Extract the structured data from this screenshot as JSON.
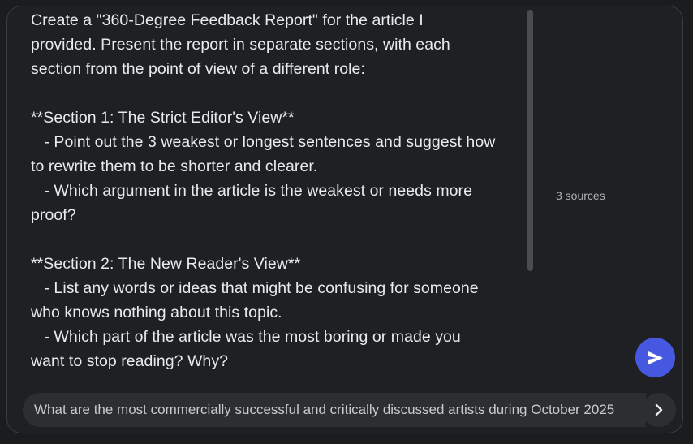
{
  "prompt": {
    "text": "Create a \"360-Degree Feedback Report\" for the article I\nprovided. Present the report in separate sections, with each\nsection from the point of view of a different role:\n\n**Section 1: The Strict Editor's View**\n   - Point out the 3 weakest or longest sentences and suggest how\nto rewrite them to be shorter and clearer.\n   - Which argument in the article is the weakest or needs more\nproof?\n\n**Section 2: The New Reader's View**\n   - List any words or ideas that might be confusing for someone\nwho knows nothing about this topic.\n   - Which part of the article was the most boring or made you\nwant to stop reading? Why?"
  },
  "sources": {
    "label": "3 sources"
  },
  "suggestion": {
    "text": "What are the most commercially successful and critically discussed artists during October 2025"
  },
  "icons": {
    "send": "send-icon",
    "next": "chevron-right-icon"
  },
  "colors": {
    "background": "#1b1c1e",
    "panel": "#1f2023",
    "accent": "#4758e0",
    "text": "#e8eaed"
  }
}
